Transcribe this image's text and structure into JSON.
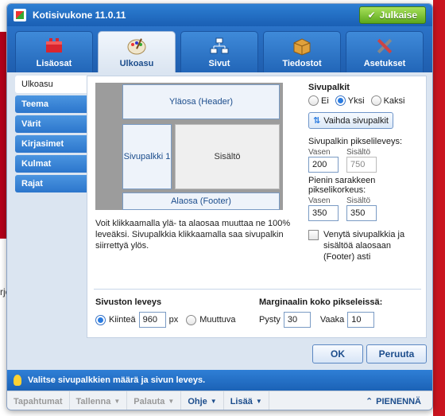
{
  "window": {
    "title": "Kotisivukone 11.0.11",
    "publish_label": "Julkaise"
  },
  "tabs": [
    {
      "label": "Lisäosat",
      "icon": "addons-icon"
    },
    {
      "label": "Ulkoasu",
      "icon": "palette-icon"
    },
    {
      "label": "Sivut",
      "icon": "sitemap-icon"
    },
    {
      "label": "Tiedostot",
      "icon": "box-icon"
    },
    {
      "label": "Asetukset",
      "icon": "tools-icon"
    }
  ],
  "sidebar": {
    "items": [
      {
        "label": "Ulkoasu"
      },
      {
        "label": "Teema"
      },
      {
        "label": "Värit"
      },
      {
        "label": "Kirjasimet"
      },
      {
        "label": "Kulmat"
      },
      {
        "label": "Rajat"
      }
    ]
  },
  "preview": {
    "header": "Yläosa (Header)",
    "sidebar": "Sivupalkki 1",
    "content": "Sisältö",
    "footer": "Alaosa (Footer)"
  },
  "help_text": "Voit klikkaamalla ylä- ta alaosaa muuttaa ne 100% leveäksi. Sivupalkkia klikkaamalla saa sivupalkin siirrettyä ylös.",
  "sidebars": {
    "title": "Sivupalkit",
    "options": [
      "Ei",
      "Yksi",
      "Kaksi"
    ],
    "selected": "Yksi",
    "swap_label": "Vaihda sivupalkit",
    "width_label": "Sivupalkin pikselileveys:",
    "left_label": "Vasen",
    "content_label": "Sisältö",
    "left_width": "200",
    "content_width": "750",
    "min_height_label": "Pienin sarakkeen pikselikorkeus:",
    "left_height": "350",
    "content_height": "350",
    "stretch_label": "Venytä sivupalkkia ja sisältöä alaosaan (Footer) asti"
  },
  "site_width": {
    "title": "Sivuston leveys",
    "fixed_label": "Kiinteä",
    "value": "960",
    "unit": "px",
    "fluid_label": "Muuttuva"
  },
  "margin": {
    "title": "Marginaalin koko pikseleissä:",
    "vertical_label": "Pysty",
    "vertical_value": "30",
    "horizontal_label": "Vaaka",
    "horizontal_value": "10"
  },
  "buttons": {
    "ok": "OK",
    "cancel": "Peruuta"
  },
  "hint": "Valitse sivupalkkien määrä ja sivun leveys.",
  "statusbar": {
    "events": "Tapahtumat",
    "save": "Tallenna",
    "restore": "Palauta",
    "help": "Ohje",
    "more": "Lisää",
    "shrink": "PIENENNÄ"
  },
  "background": {
    "peek_text": "rje"
  }
}
